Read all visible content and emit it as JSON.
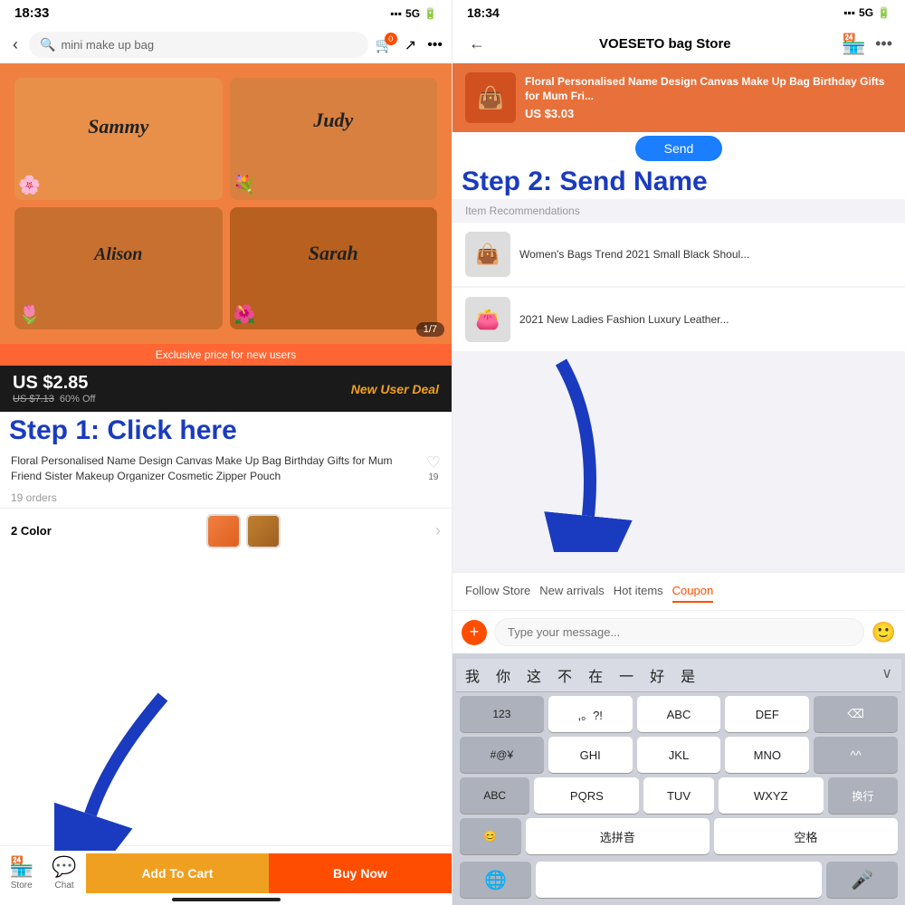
{
  "left": {
    "status_time": "18:33",
    "network": "5G",
    "search_placeholder": "mini make up bag",
    "cart_badge": "0",
    "image_counter": "1/7",
    "exclusive_bar": "Exclusive price for new users",
    "price_main": "US $2.85",
    "price_old": "US $7.13",
    "price_discount": "60% Off",
    "new_user_deal": "New User Deal",
    "step1_text": "Step 1: Click here",
    "product_title": "Floral Personalised Name Design Canvas Make Up Bag Birthday Gifts for Mum Friend Sister Makeup Organizer Cosmetic Zipper Pouch",
    "wishlist_count": "19",
    "orders_text": "19 orders",
    "colors_label": "2 Color",
    "add_to_cart": "Add To Cart",
    "buy_now": "Buy Now",
    "store_label": "Store",
    "chat_label": "Chat",
    "bag_names": [
      "Sammy",
      "Judy",
      "Alison",
      "Sarah"
    ]
  },
  "right": {
    "status_time": "18:34",
    "network": "5G",
    "store_title": "VOESETO bag Store",
    "promo_product_title": "Floral Personalised Name Design Canvas Make Up Bag Birthday Gifts for Mum Fri...",
    "promo_price": "US $3.03",
    "send_button": "Send",
    "step2_text": "Step 2: Send Name",
    "rec_label": "Item Recommendations",
    "rec_items": [
      {
        "title": "Women's Bags Trend 2021 Small Black Shoul..."
      },
      {
        "title": "2021 New Ladies Fashion Luxury Leather..."
      }
    ],
    "quick_actions": [
      "Follow Store",
      "New arrivals",
      "Hot items",
      "Coupon"
    ],
    "message_placeholder": "Type your message...",
    "keyboard_suggestions": [
      "我",
      "你",
      "这",
      "不",
      "在",
      "一",
      "好",
      "是"
    ],
    "keyboard_rows": [
      [
        "123",
        ",。?!",
        "ABC",
        "DEF",
        "⌫"
      ],
      [
        "#@¥",
        "GHI",
        "JKL",
        "MNO",
        "^^"
      ],
      [
        "ABC",
        "PQRS",
        "TUV",
        "WXYZ",
        "换行"
      ],
      [
        "😊",
        "选拼音",
        "空格",
        ""
      ]
    ]
  }
}
